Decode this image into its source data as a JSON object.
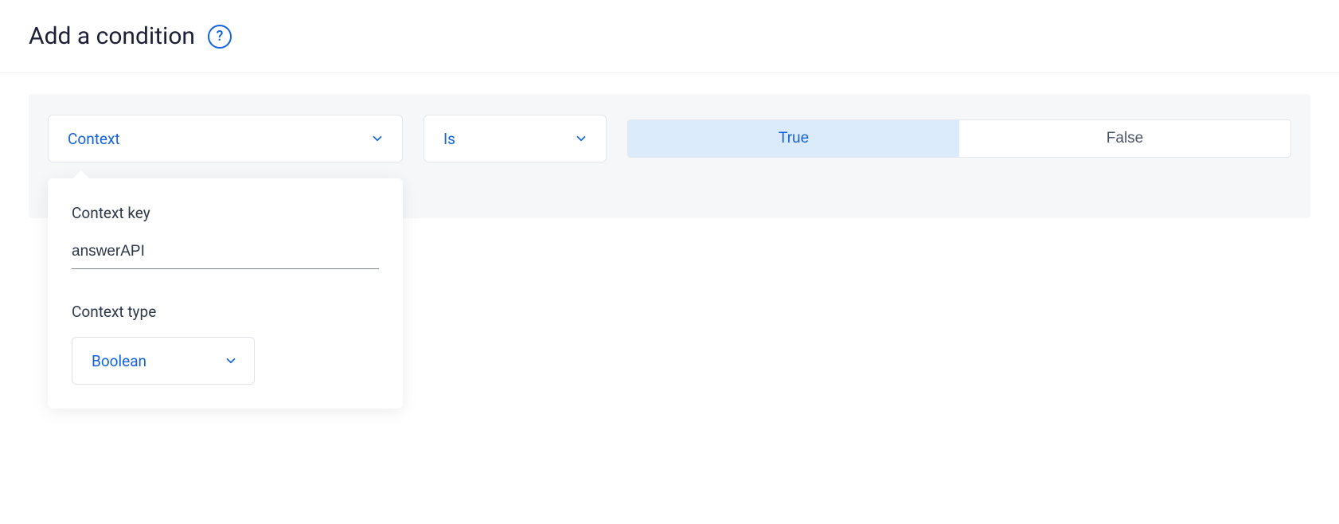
{
  "header": {
    "title": "Add a condition"
  },
  "condition": {
    "subject": "Context",
    "operator": "Is",
    "value_true": "True",
    "value_false": "False",
    "selected": "true"
  },
  "popover": {
    "key_label": "Context key",
    "key_value": "answerAPI",
    "type_label": "Context type",
    "type_value": "Boolean"
  }
}
